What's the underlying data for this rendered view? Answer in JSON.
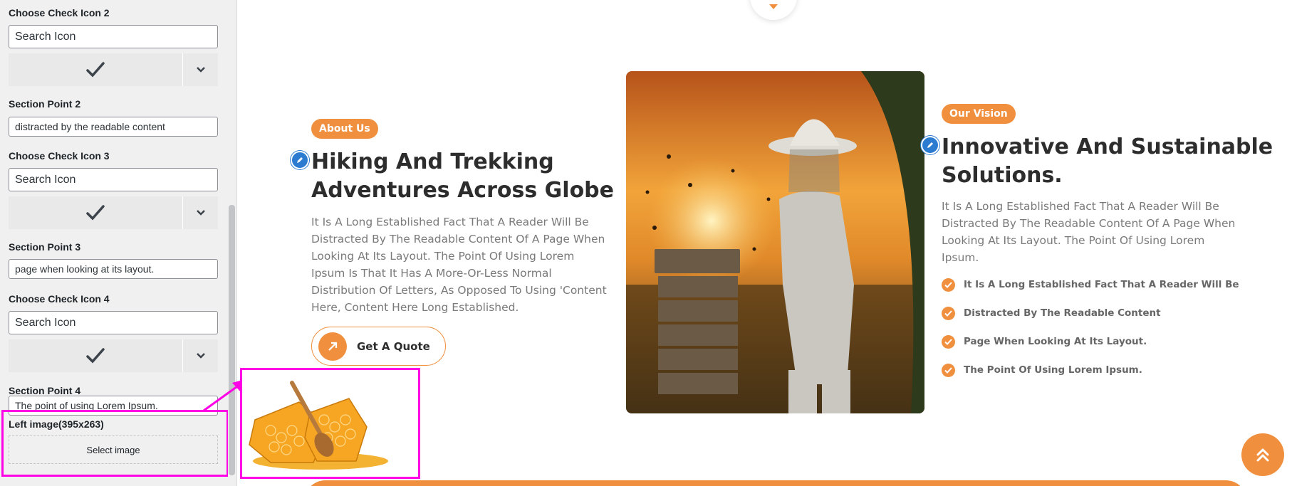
{
  "panel": {
    "check_icon_2": {
      "label": "Choose Check Icon 2",
      "placeholder": "Search Icon"
    },
    "section_point_2": {
      "label": "Section Point 2",
      "value": "distracted by the readable content"
    },
    "check_icon_3": {
      "label": "Choose Check Icon 3",
      "placeholder": "Search Icon"
    },
    "section_point_3": {
      "label": "Section Point 3",
      "value": "page when looking at its layout."
    },
    "check_icon_4": {
      "label": "Choose Check Icon 4",
      "placeholder": "Search Icon"
    },
    "section_point_4": {
      "label": "Section Point 4",
      "value": "The point of using Lorem Ipsum."
    },
    "left_image": {
      "label": "Left image(395x263)",
      "button": "Select image"
    }
  },
  "about": {
    "badge": "About Us",
    "title_line1": "Hiking And Trekking",
    "title_line2": "Adventures Across Globe",
    "paragraph_lines": [
      "It Is A Long Established Fact That A Reader Will Be",
      "Distracted By The Readable Content Of A Page When",
      "Looking At Its Layout. The Point Of Using Lorem",
      "Ipsum Is That It Has A More-Or-Less Normal",
      "Distribution Of Letters, As Opposed To Using 'Content",
      "Here, Content Here Long Established."
    ],
    "button": "Get A Quote"
  },
  "vision": {
    "badge": "Our Vision",
    "title_line1": "Innovative And Sustainable",
    "title_line2": "Solutions.",
    "paragraph_lines": [
      "It Is A Long Established Fact That A Reader Will Be",
      "Distracted By The Readable Content Of A Page When",
      "Looking At Its Layout. The Point Of Using Lorem",
      "Ipsum."
    ],
    "points": [
      "It Is A Long Established Fact That A Reader Will Be",
      "Distracted By The Readable Content",
      "Page When Looking At Its Layout.",
      "The Point Of Using Lorem Ipsum."
    ]
  },
  "icons": {
    "check": "checkmark-icon",
    "dropdown": "chevron-down-icon",
    "edit": "pencil-icon",
    "quote": "arrow-up-right-icon",
    "scroll_top": "double-chevron-up-icon"
  },
  "colors": {
    "accent": "#f0903f",
    "highlight": "#ff00e6",
    "edit": "#2b7bd1"
  }
}
